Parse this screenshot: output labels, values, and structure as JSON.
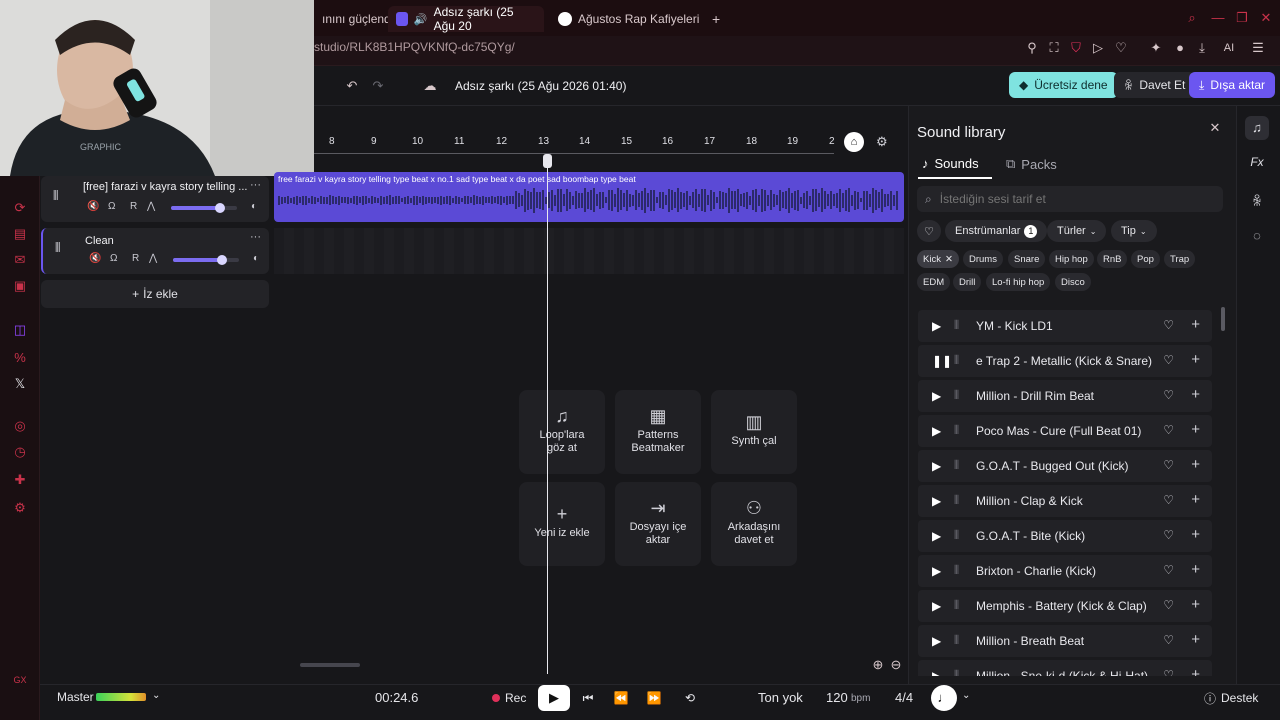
{
  "browser": {
    "tabs": [
      {
        "label": "ınını güçlendi",
        "active": false
      },
      {
        "label": "Adsız şarkı (25 Ağu 20",
        "active": true
      },
      {
        "label": "Ağustos Rap Kafiyeleri",
        "active": false
      }
    ],
    "new_tab": "+",
    "url": "studio/RLK8B1HPQVKNfQ-dc75QYg/",
    "ai_label": "AI"
  },
  "header": {
    "song_title": "Adsız şarkı (25 Ağu 2026 01:40)",
    "try_free": "Ücretsiz dene",
    "invite": "Davet Et",
    "export": "Dışa aktar"
  },
  "tracks": [
    {
      "title": "[free] farazi v kayra story telling ...",
      "rec": "R"
    },
    {
      "title": "Clean",
      "rec": "R"
    }
  ],
  "add_track": "İz ekle",
  "ruler_ticks": [
    "8",
    "9",
    "10",
    "11",
    "12",
    "13",
    "14",
    "15",
    "16",
    "17",
    "18",
    "19",
    "2"
  ],
  "clip_label": "free farazi v kayra story telling type beat x no.1 sad type beat x da poet sad boombap type beat",
  "tiles": [
    {
      "label": "Loop'lara göz at"
    },
    {
      "label": "Patterns Beatmaker"
    },
    {
      "label": "Synth çal"
    },
    {
      "label": "Yeni iz ekle"
    },
    {
      "label": "Dosyayı içe aktar"
    },
    {
      "label": "Arkadaşını davet et"
    }
  ],
  "library": {
    "title": "Sound library",
    "tab_sounds": "Sounds",
    "tab_packs": "Packs",
    "search_placeholder": "İstediğin sesi tarif et",
    "filter_instruments": "Enstrümanlar",
    "filter_count": "1",
    "filter_genres": "Türler",
    "filter_type": "Tip",
    "chips_row1": [
      "Kick",
      "Drums",
      "Snare",
      "Hip hop",
      "RnB",
      "Pop",
      "Trap"
    ],
    "chips_row2": [
      "EDM",
      "Drill",
      "Lo-fi hip hop",
      "Disco"
    ],
    "sounds": [
      {
        "name": "YM - Kick LD1",
        "playing": false
      },
      {
        "name": "e Trap 2 - Metallic (Kick & Snare)",
        "playing": true
      },
      {
        "name": "Million - Drill Rim Beat",
        "playing": false
      },
      {
        "name": "Poco Mas - Cure (Full Beat 01)",
        "playing": false
      },
      {
        "name": "G.O.A.T - Bugged Out (Kick)",
        "playing": false
      },
      {
        "name": "Million - Clap & Kick",
        "playing": false
      },
      {
        "name": "G.O.A.T - Bite (Kick)",
        "playing": false
      },
      {
        "name": "Brixton - Charlie (Kick)",
        "playing": false
      },
      {
        "name": "Memphis - Battery (Kick & Clap)",
        "playing": false
      },
      {
        "name": "Million - Breath Beat",
        "playing": false
      },
      {
        "name": "Million - Sne-ki-d (Kick & Hi-Hat)",
        "playing": false
      }
    ]
  },
  "rail": {
    "fx": "Fx"
  },
  "transport": {
    "master": "Master",
    "time": "00:24.6",
    "rec": "Rec",
    "key": "Ton yok",
    "bpm_value": "120",
    "bpm_unit": "bpm",
    "signature": "4/4",
    "support": "Destek"
  },
  "colors": {
    "accent": "#5b4ad6",
    "teal": "#7fe3e0",
    "export": "#6b56f0",
    "rec": "#e0305a"
  }
}
